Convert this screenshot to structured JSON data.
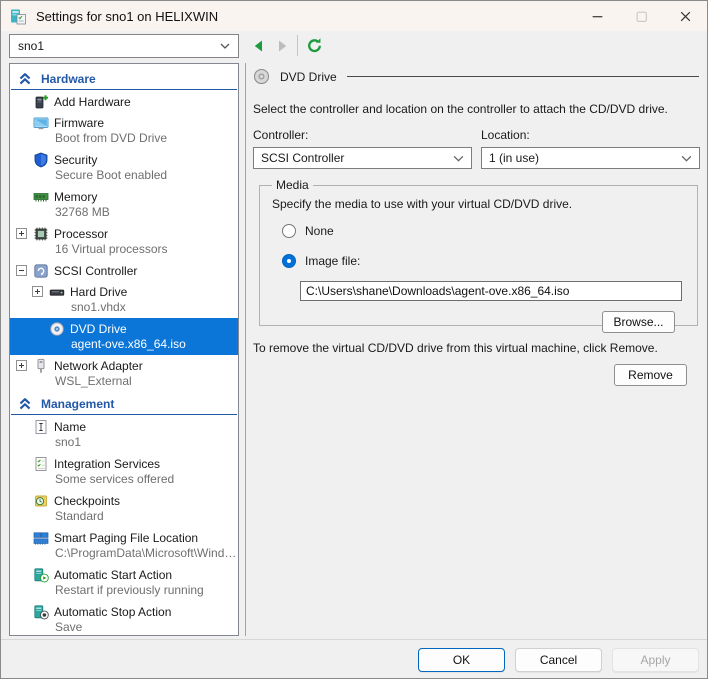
{
  "window": {
    "title": "Settings for sno1 on HELIXWIN"
  },
  "toolbar": {
    "vm_selector_value": "sno1",
    "back_icon": "back-icon",
    "forward_icon": "forward-icon",
    "refresh_icon": "refresh-icon"
  },
  "sidebar": {
    "sections": [
      {
        "label": "Hardware",
        "items": [
          {
            "icon": "add-hardware-icon",
            "label": "Add Hardware"
          },
          {
            "icon": "firmware-icon",
            "label": "Firmware",
            "subtitle": "Boot from DVD Drive"
          },
          {
            "icon": "security-icon",
            "label": "Security",
            "subtitle": "Secure Boot enabled"
          },
          {
            "icon": "memory-icon",
            "label": "Memory",
            "subtitle": "32768 MB"
          },
          {
            "icon": "processor-icon",
            "label": "Processor",
            "subtitle": "16 Virtual processors",
            "expander": "+"
          },
          {
            "icon": "scsi-controller-icon",
            "label": "SCSI Controller",
            "expander": "-"
          },
          {
            "icon": "hard-drive-icon",
            "label": "Hard Drive",
            "subtitle": "sno1.vhdx",
            "expander": "+",
            "indent": 1
          },
          {
            "icon": "dvd-drive-icon",
            "label": "DVD Drive",
            "subtitle": "agent-ove.x86_64.iso",
            "indent": 1,
            "selected": true
          },
          {
            "icon": "network-adapter-icon",
            "label": "Network Adapter",
            "subtitle": "WSL_External",
            "expander": "+"
          }
        ]
      },
      {
        "label": "Management",
        "items": [
          {
            "icon": "name-icon",
            "label": "Name",
            "subtitle": "sno1"
          },
          {
            "icon": "integration-services-icon",
            "label": "Integration Services",
            "subtitle": "Some services offered"
          },
          {
            "icon": "checkpoints-icon",
            "label": "Checkpoints",
            "subtitle": "Standard"
          },
          {
            "icon": "smart-paging-icon",
            "label": "Smart Paging File Location",
            "subtitle": "C:\\ProgramData\\Microsoft\\Windo..."
          },
          {
            "icon": "auto-start-icon",
            "label": "Automatic Start Action",
            "subtitle": "Restart if previously running"
          },
          {
            "icon": "auto-stop-icon",
            "label": "Automatic Stop Action",
            "subtitle": "Save"
          }
        ]
      }
    ]
  },
  "panel": {
    "title": "DVD Drive",
    "intro": "Select the controller and location on the controller to attach the CD/DVD drive.",
    "controller_label": "Controller:",
    "controller_value": "SCSI Controller",
    "location_label": "Location:",
    "location_value": "1 (in use)",
    "media": {
      "legend": "Media",
      "description": "Specify the media to use with your virtual CD/DVD drive.",
      "options": [
        {
          "label": "None",
          "selected": false
        },
        {
          "label": "Image file:",
          "selected": true
        }
      ],
      "image_path": "C:\\Users\\shane\\Downloads\\agent-ove.x86_64.iso",
      "browse_label": "Browse..."
    },
    "remove_hint": "To remove the virtual CD/DVD drive from this virtual machine, click Remove.",
    "remove_label": "Remove"
  },
  "footer": {
    "ok_label": "OK",
    "cancel_label": "Cancel",
    "apply_label": "Apply"
  },
  "colors": {
    "selection_blue": "#0c76d8",
    "section_header_blue": "#2358a7",
    "ok_accent_border": "#0067c0",
    "toolbar_green": "#1c9c3f",
    "titlebar_bg": "#faf4f1",
    "window_bg": "#f0f0f0"
  }
}
